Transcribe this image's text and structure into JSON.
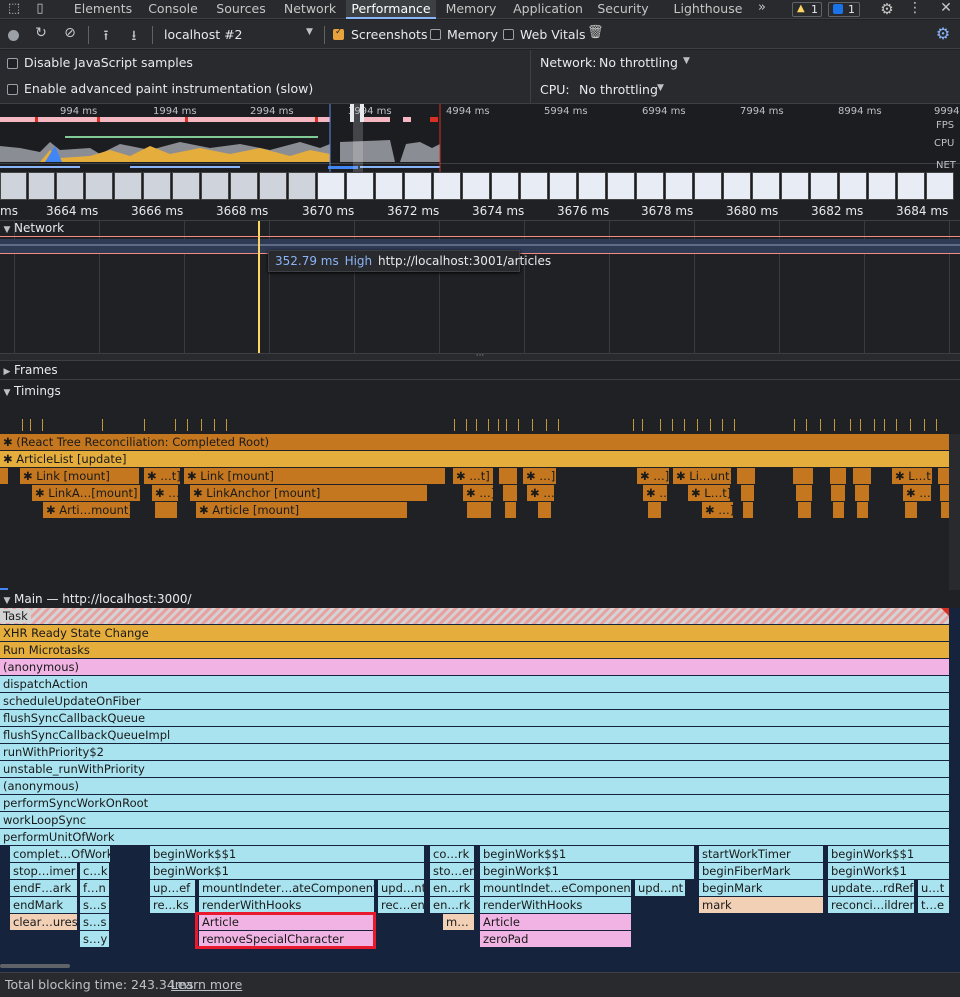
{
  "tabs": [
    "Elements",
    "Console",
    "Sources",
    "Network",
    "Performance",
    "Memory",
    "Application",
    "Security",
    "Lighthouse"
  ],
  "more_tabs": "»",
  "warnings_count": "1",
  "messages_count": "1",
  "toolbar": {
    "profile_select": "localhost #2",
    "screenshots_label": "Screenshots",
    "memory_label": "Memory",
    "web_vitals_label": "Web Vitals"
  },
  "settings": {
    "disable_js_samples": "Disable JavaScript samples",
    "advanced_paint": "Enable advanced paint instrumentation (slow)",
    "network_label": "Network:",
    "network_value": "No throttling",
    "cpu_label": "CPU:",
    "cpu_value": "No throttling"
  },
  "overview": {
    "ticks": [
      "994 ms",
      "1994 ms",
      "2994 ms",
      "3994 ms",
      "4994 ms",
      "5994 ms",
      "6994 ms",
      "7994 ms",
      "8994 ms",
      "9994"
    ],
    "labels": {
      "fps": "FPS",
      "cpu": "CPU",
      "net": "NET"
    }
  },
  "ruler": [
    "ms",
    "3664 ms",
    "3666 ms",
    "3668 ms",
    "3670 ms",
    "3672 ms",
    "3674 ms",
    "3676 ms",
    "3678 ms",
    "3680 ms",
    "3682 ms",
    "3684 ms"
  ],
  "network_section": "Network",
  "tooltip": {
    "time": "352.79 ms",
    "priority": "High",
    "url": "http://localhost:3001/articles"
  },
  "frames_section": "Frames",
  "timings_section": "Timings",
  "timings": {
    "reconciliation": "(React Tree Reconciliation: Completed Root)",
    "article_list": "ArticleList [update]",
    "link_mount_1": "Link [mount]",
    "t1": "…t]",
    "link_mount_2": "Link [mount]",
    "t2": "…t]",
    "t3": "…]",
    "t4": "…]",
    "li_unt": "Li…unt]",
    "l_t": "L…t]",
    "linka_mount": "LinkA…[mount]",
    "ellip1": "…",
    "linkanchor_mount": "LinkAnchor [mount]",
    "e2": "…]",
    "e3": "…]",
    "e4": "…]",
    "l_t2": "L…t]",
    "e5": "…]",
    "arti_mount": "Arti…mount]",
    "article_mount": "Article [mount]",
    "e6": "…]"
  },
  "main_section": "Main — http://localhost:3000/",
  "flame_rows": [
    "Task",
    "XHR Ready State Change",
    "Run Microtasks",
    "(anonymous)",
    "dispatchAction",
    "scheduleUpdateOnFiber",
    "flushSyncCallbackQueue",
    "flushSyncCallbackQueueImpl",
    "runWithPriority$2",
    "unstable_runWithPriority",
    "(anonymous)",
    "performSyncWorkOnRoot",
    "workLoopSync",
    "performUnitOfWork"
  ],
  "flame_bars": {
    "r1": [
      "complet…OfWork",
      "beginWork$$1",
      "co…rk",
      "beginWork$$1",
      "startWorkTimer",
      "beginWork$$1"
    ],
    "r2": [
      "stop…imer",
      "c…k",
      "beginWork$1",
      "sto…er",
      "beginWork$1",
      "beginFiberMark",
      "beginWork$1"
    ],
    "r3": [
      "endF…ark",
      "f…n",
      "up…ef",
      "mountIndeter…ateComponent",
      "upd…nt",
      "en…rk",
      "mountIndet…eComponent",
      "upd…nt",
      "beginMark",
      "update…rdRef",
      "u…t"
    ],
    "r4": [
      "endMark",
      "s…s",
      "re…ks",
      "renderWithHooks",
      "rec…en",
      "en…rk",
      "renderWithHooks",
      "mark",
      "reconci…ildren",
      "t…e"
    ],
    "r5": [
      "clear…ures",
      "s…s",
      "Article",
      "m…",
      "Article"
    ],
    "r6": [
      "s…y",
      "removeSpecialCharacter",
      "zeroPad"
    ]
  },
  "footer": {
    "tbt": "Total blocking time: 243.34ms",
    "learn_more": "Learn more"
  }
}
